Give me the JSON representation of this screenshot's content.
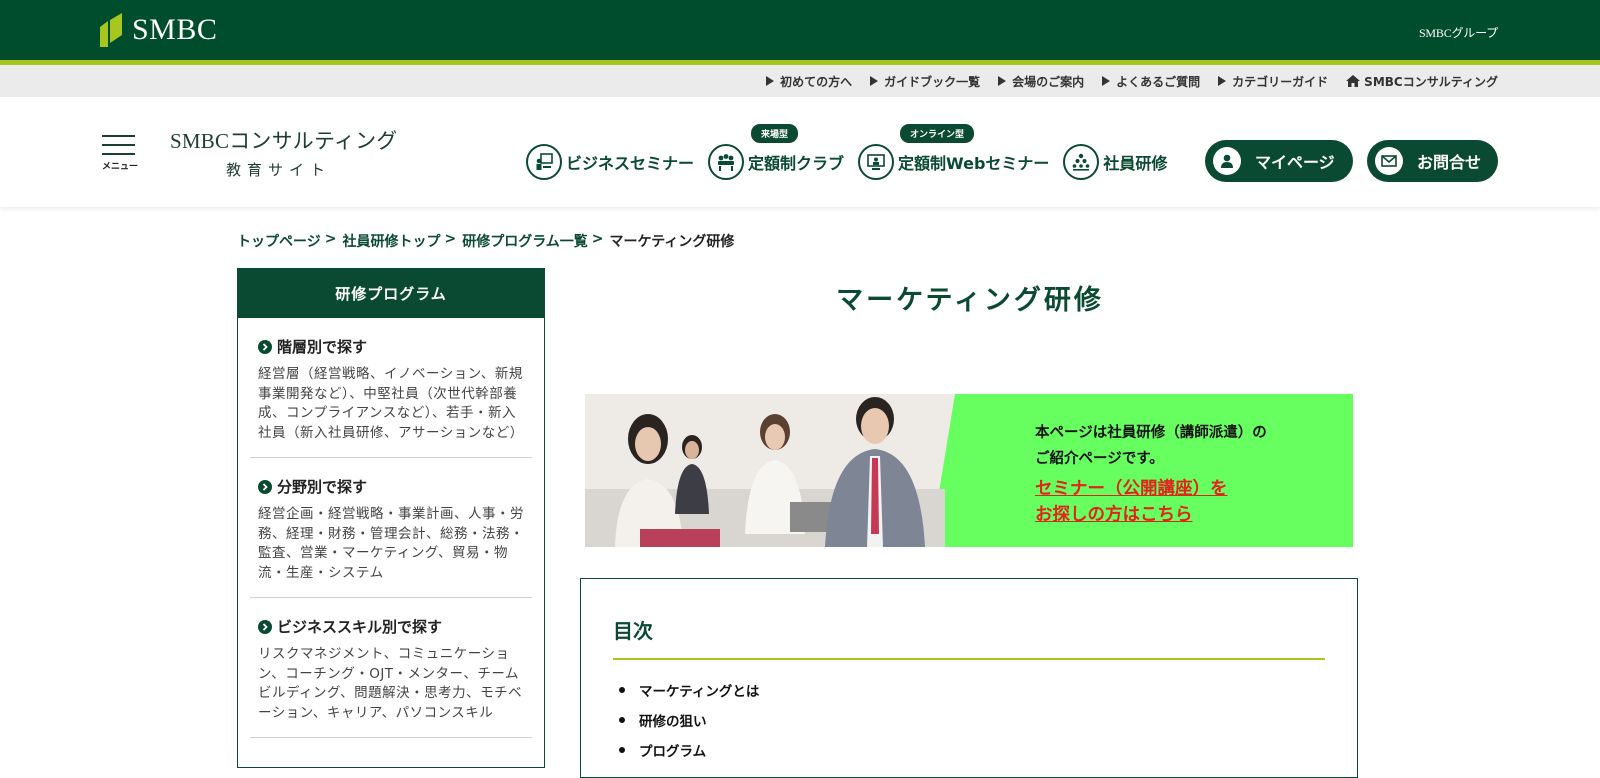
{
  "group_bar": {
    "logo_text": "SMBC",
    "group_label": "SMBCグループ"
  },
  "util_links": [
    {
      "label": "初めての方へ"
    },
    {
      "label": "ガイドブック一覧"
    },
    {
      "label": "会場のご案内"
    },
    {
      "label": "よくあるご質問"
    },
    {
      "label": "カテゴリーガイド"
    },
    {
      "label": "SMBCコンサルティング",
      "icon": "house-icon"
    }
  ],
  "header": {
    "menu_label": "メニュー",
    "site_name": "SMBCコンサルティング",
    "site_sub": "教育サイト",
    "nav": [
      {
        "label": "ビジネスセミナー",
        "icon": "seminar-icon"
      },
      {
        "label": "定額制クラブ",
        "badge": "来場型",
        "icon": "club-icon"
      },
      {
        "label": "定額制Webセミナー",
        "badge": "オンライン型",
        "icon": "web-seminar-icon"
      },
      {
        "label": "社員研修",
        "icon": "training-icon"
      }
    ],
    "mypage_label": "マイページ",
    "contact_label": "お問合せ"
  },
  "breadcrumb": {
    "items": [
      "トップページ",
      "社員研修トップ",
      "研修プログラム一覧"
    ],
    "separator": ">",
    "current": "マーケティング研修"
  },
  "sidebar": {
    "heading": "研修プログラム",
    "sections": [
      {
        "title": "階層別で探す",
        "desc": "経営層（経営戦略、イノベーション、新規事業開発など）、中堅社員（次世代幹部養成、コンプライアンスなど）、若手・新入社員（新入社員研修、アサーションなど）"
      },
      {
        "title": "分野別で探す",
        "desc": "経営企画・経営戦略・事業計画、人事・労務、経理・財務・管理会計、総務・法務・監査、営業・マーケティング、貿易・物流・生産・システム"
      },
      {
        "title": "ビジネススキル別で探す",
        "desc": "リスクマネジメント、コミュニケーション、コーチング・OJT・メンター、チームビルディング、問題解決・思考力、モチベーション、キャリア、パソコンスキル"
      }
    ]
  },
  "main": {
    "title": "マーケティング研修",
    "banner": {
      "line1": "本ページは社員研修（講師派遣）の",
      "line2": "ご紹介ページです。",
      "link1": "セミナー（公開講座）を",
      "link2": "お探しの方はこちら",
      "bg_color": "#66ff5f",
      "link_color": "#e0241b"
    },
    "toc": {
      "title": "目次",
      "items": [
        "マーケティングとは",
        "研修の狙い",
        "プログラム"
      ]
    }
  },
  "colors": {
    "brand_green": "#004d2e",
    "accent_lime": "#a7c620",
    "nav_green": "#0b4a32"
  }
}
